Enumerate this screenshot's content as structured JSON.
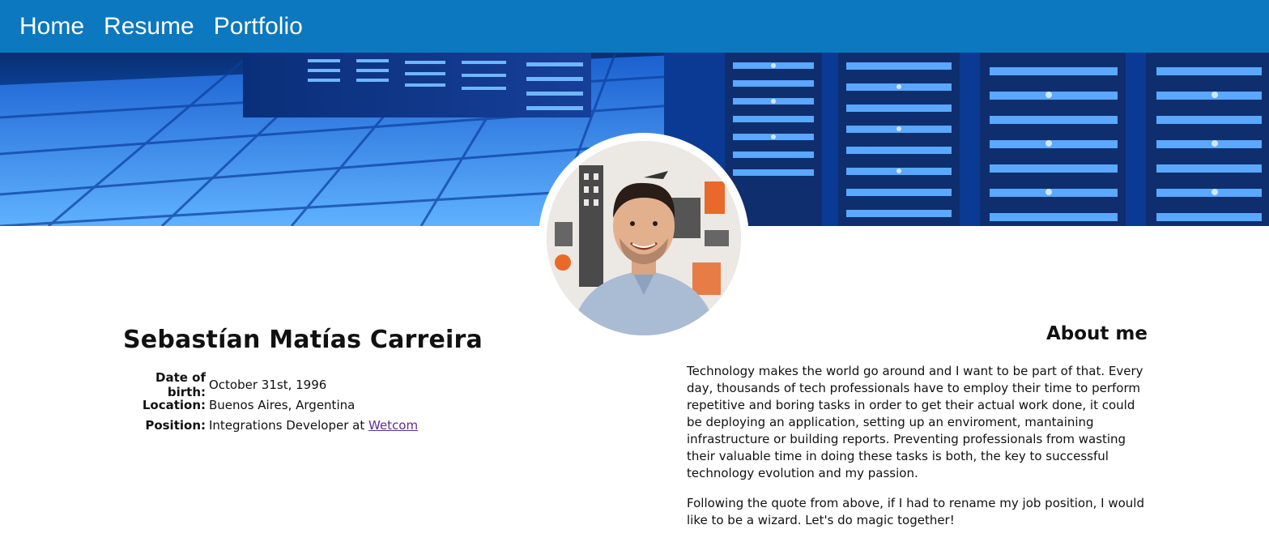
{
  "nav": {
    "items": [
      "Home",
      "Resume",
      "Portfolio"
    ]
  },
  "profile": {
    "name": "Sebastían Matías Carreira",
    "details": [
      {
        "label": "Date of birth:",
        "value": "October 31st, 1996"
      },
      {
        "label": "Location:",
        "value": "Buenos Aires, Argentina"
      },
      {
        "label": "Position:",
        "value": "Integrations Developer at ",
        "link_text": "Wetcom"
      }
    ]
  },
  "about": {
    "title": "About me",
    "paragraphs": [
      "Technology makes the world go around and I want to be part of that. Every day, thousands of tech professionals have to employ their time to perform repetitive and boring tasks in order to get their actual work done, it could be deploying an application, setting up an enviroment, mantaining infrastructure or building reports. Preventing professionals from wasting their valuable time in doing these tasks is both, the key to successful technology evolution and my passion.",
      "Following the quote from above, if I had to rename my job position, I would like to be a wizard. Let's do magic together!"
    ]
  },
  "colors": {
    "navbar": "#0b78bf",
    "link": "#5c2d91"
  },
  "images": {
    "banner": "server-room-banner",
    "avatar": "profile-photo"
  }
}
